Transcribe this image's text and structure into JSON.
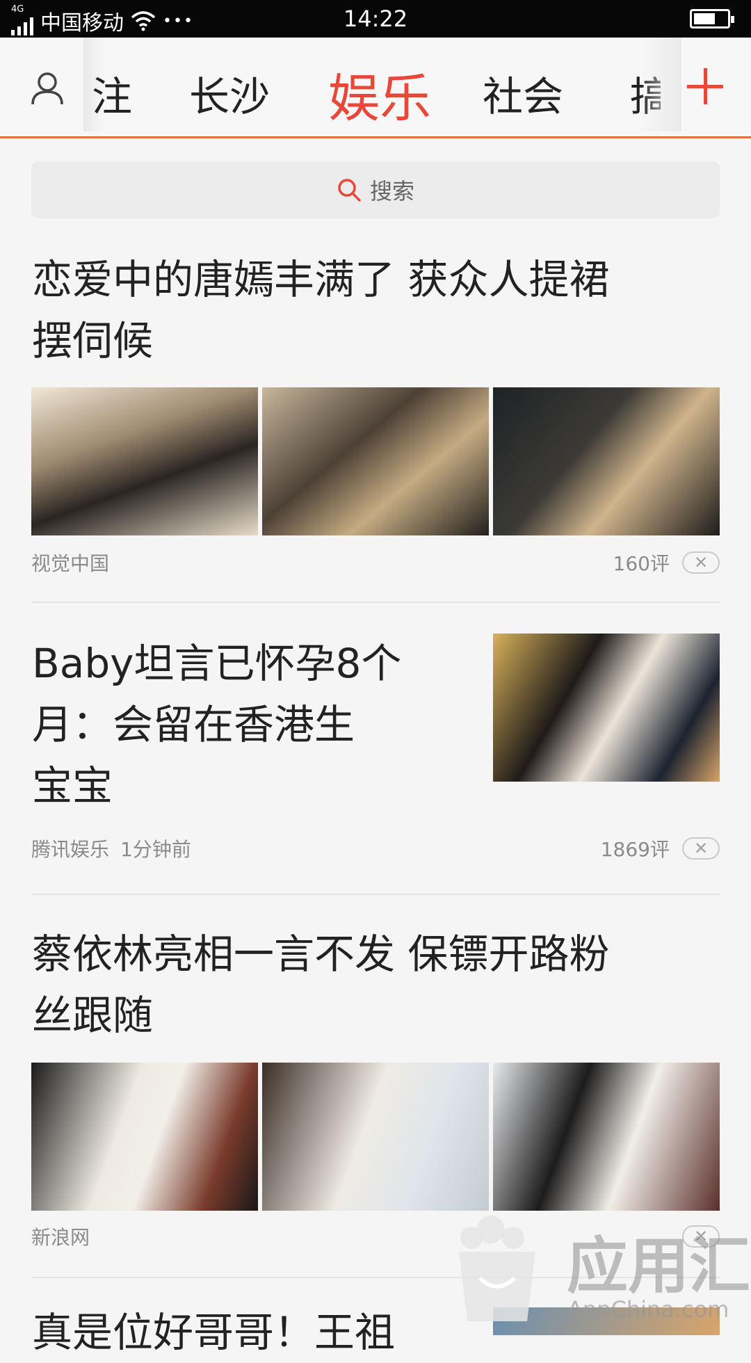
{
  "status_bar": {
    "network": "4G",
    "carrier": "中国移动",
    "more": "•••",
    "time": "14:22"
  },
  "tabs": {
    "items": [
      {
        "label": "注",
        "active": false
      },
      {
        "label": "长沙",
        "active": false
      },
      {
        "label": "娱乐",
        "active": true
      },
      {
        "label": "社会",
        "active": false
      },
      {
        "label": "搞",
        "active": false
      }
    ],
    "accent_color": "#e8483a"
  },
  "search": {
    "placeholder": "搜索"
  },
  "news": [
    {
      "title_lines": [
        "恋爱中的唐嫣丰满了 获众人提裙",
        "摆伺候"
      ],
      "source": "视觉中国",
      "time": "",
      "comments": "160评",
      "layout": "three-images"
    },
    {
      "title_lines": [
        "Baby坦言已怀孕8个",
        "月：会留在香港生",
        "宝宝"
      ],
      "source": "腾讯娱乐",
      "time": "1分钟前",
      "comments": "1869评",
      "layout": "right-image"
    },
    {
      "title_lines": [
        "蔡依林亮相一言不发 保镖开路粉",
        "丝跟随"
      ],
      "source": "新浪网",
      "time": "",
      "comments": "",
      "layout": "three-images"
    },
    {
      "title_lines": [
        "真是位好哥哥！王祖"
      ],
      "source": "",
      "time": "",
      "comments": "",
      "layout": "right-image"
    }
  ],
  "close_glyph": "✕",
  "watermark": {
    "text_cn": "应用汇",
    "text_en": "AppChina.com"
  }
}
